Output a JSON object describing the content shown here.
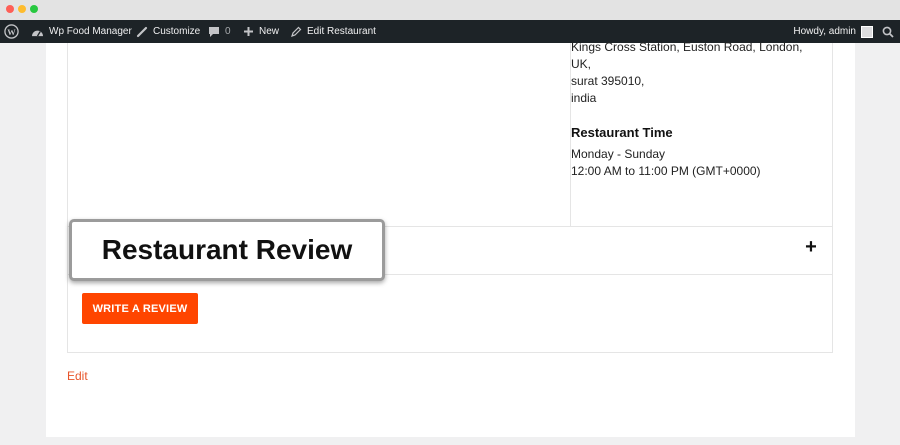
{
  "adminbar": {
    "site_name": "Wp Food Manager",
    "customize": "Customize",
    "comments_count": "0",
    "new_label": "New",
    "edit_label": "Edit Restaurant",
    "howdy": "Howdy, admin"
  },
  "address": {
    "lines": [
      "Kings Cross Station, Euston Road, London,",
      "UK,",
      "surat 395010,",
      "india"
    ]
  },
  "restaurant_time": {
    "title": "Restaurant Time",
    "days": "Monday - Sunday",
    "hours": "12:00 AM to 11:00 PM (GMT+0000)"
  },
  "review": {
    "heading": "Restaurant Review",
    "toggle": "+",
    "write_button": "WRITE A REVIEW"
  },
  "edit_link": "Edit",
  "colors": {
    "accent": "#ff4500",
    "link": "#e8552a",
    "adminbar": "#1d2327"
  }
}
